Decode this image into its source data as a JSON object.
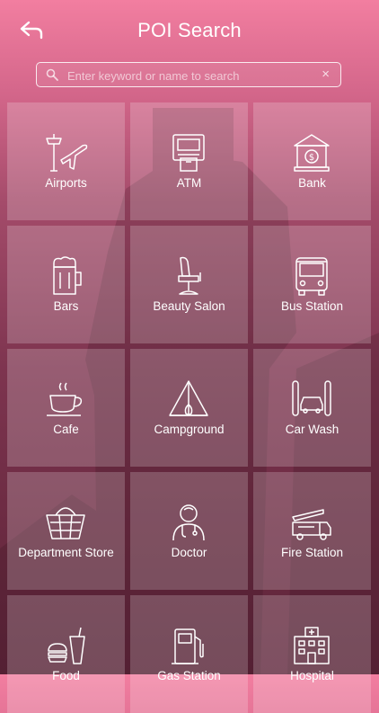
{
  "header": {
    "title": "POI Search",
    "back_icon": "back-arrow-icon"
  },
  "search": {
    "placeholder": "Enter keyword or name to search",
    "value": "",
    "clear_label": "×"
  },
  "categories": [
    {
      "label": "Airports",
      "icon": "airport-icon"
    },
    {
      "label": "ATM",
      "icon": "atm-icon"
    },
    {
      "label": "Bank",
      "icon": "bank-icon"
    },
    {
      "label": "Bars",
      "icon": "beer-icon"
    },
    {
      "label": "Beauty Salon",
      "icon": "salon-chair-icon"
    },
    {
      "label": "Bus Station",
      "icon": "bus-icon"
    },
    {
      "label": "Cafe",
      "icon": "coffee-cup-icon"
    },
    {
      "label": "Campground",
      "icon": "tent-icon"
    },
    {
      "label": "Car Wash",
      "icon": "car-wash-icon"
    },
    {
      "label": "Department Store",
      "icon": "basket-icon"
    },
    {
      "label": "Doctor",
      "icon": "doctor-icon"
    },
    {
      "label": "Fire Station",
      "icon": "fire-truck-icon"
    },
    {
      "label": "Food",
      "icon": "food-icon"
    },
    {
      "label": "Gas Station",
      "icon": "gas-pump-icon"
    },
    {
      "label": "Hospital",
      "icon": "hospital-icon"
    }
  ],
  "colors": {
    "header_top": "#f27ea0",
    "bottom": "#5e253a",
    "tile": "rgba(255,255,255,0.20)"
  }
}
